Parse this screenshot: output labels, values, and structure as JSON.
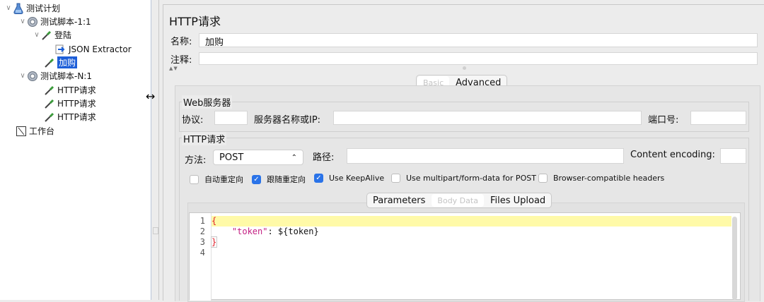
{
  "tree": {
    "root": "测试计划",
    "thread1": "测试脚本-1:1",
    "login": "登陆",
    "extractor": "JSON Extractor",
    "cart": "加购",
    "thread2": "测试脚本-N:1",
    "req1": "HTTP请求",
    "req2": "HTTP请求",
    "req3": "HTTP请求",
    "workbench": "工作台"
  },
  "panel": {
    "title": "HTTP请求",
    "name_label": "名称:",
    "name_value": "加购",
    "comment_label": "注释:",
    "comment_value": "",
    "tabs": {
      "basic": "Basic",
      "advanced": "Advanced"
    },
    "web_server": {
      "title": "Web服务器",
      "protocol_label": "协议:",
      "protocol_value": "",
      "server_label": "服务器名称或IP:",
      "server_value": "",
      "port_label": "端口号:",
      "port_value": ""
    },
    "http_request": {
      "title": "HTTP请求",
      "method_label": "方法:",
      "method_value": "POST",
      "path_label": "路径:",
      "path_value": "",
      "encoding_label": "Content encoding:",
      "encoding_value": ""
    },
    "checkboxes": [
      {
        "label": "自动重定向",
        "checked": false
      },
      {
        "label": "跟随重定向",
        "checked": true
      },
      {
        "label": "Use KeepAlive",
        "checked": true
      },
      {
        "label": "Use multipart/form-data for POST",
        "checked": false
      },
      {
        "label": "Browser-compatible headers",
        "checked": false
      }
    ],
    "body_tabs": {
      "parameters": "Parameters",
      "body_data": "Body Data",
      "files_upload": "Files Upload"
    },
    "editor": {
      "line_numbers": [
        "1",
        "2",
        "3",
        "4"
      ],
      "line1": "{",
      "line2_key": "\"token\"",
      "line2_rest": ": ${token}",
      "line3": "}"
    }
  }
}
